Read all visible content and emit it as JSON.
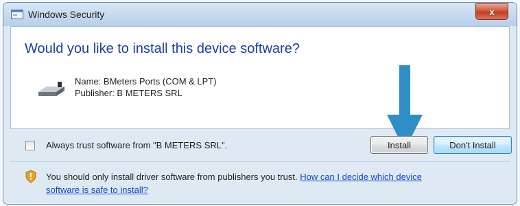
{
  "window": {
    "title": "Windows Security",
    "close_label": "x"
  },
  "dialog": {
    "heading": "Would you like to install this device software?",
    "device": {
      "name_line": "Name: BMeters Ports (COM & LPT)",
      "publisher_line": "Publisher: B METERS SRL"
    }
  },
  "options": {
    "always_trust_label": "Always trust software from \"B METERS SRL\".",
    "always_trust_checked": false
  },
  "buttons": {
    "install": "Install",
    "dont_install": "Don't Install"
  },
  "footer": {
    "message": "You should only install driver software from publishers you trust. ",
    "link_text": "How can I decide which device software is safe to install?"
  },
  "colors": {
    "heading": "#1a3e9c",
    "link": "#0d49d1",
    "arrow": "#2f8ec8"
  }
}
